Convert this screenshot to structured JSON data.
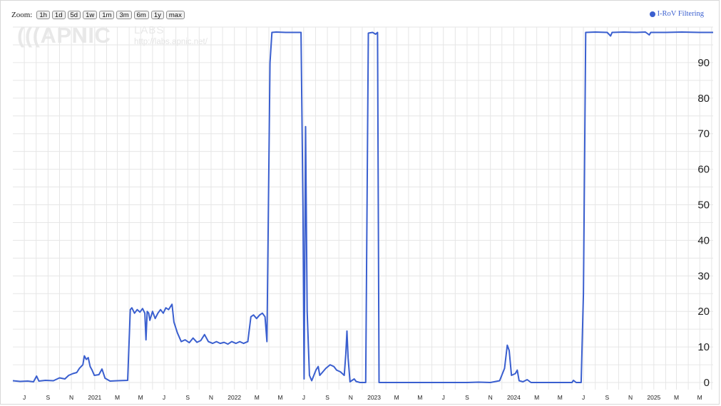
{
  "zoom": {
    "label": "Zoom:",
    "buttons": [
      "1h",
      "1d",
      "5d",
      "1w",
      "1m",
      "3m",
      "6m",
      "1y",
      "max"
    ]
  },
  "legend": {
    "label": "I-RoV Filtering",
    "color": "#3a5fcf"
  },
  "watermark": {
    "logo": "(((APNIC",
    "labs": "LABS",
    "url": "http://labs.apnic.net/"
  },
  "chart_data": {
    "type": "line",
    "title": "",
    "xlabel": "",
    "ylabel": "",
    "grid": true,
    "legend_position": "top-right",
    "y_axis_side": "right",
    "x_range": [
      "2020-06-01",
      "2025-06-05"
    ],
    "y_range": [
      -2,
      100
    ],
    "x_ticks": [
      {
        "label": "J",
        "date": "2020-07-01"
      },
      {
        "label": "S",
        "date": "2020-09-01"
      },
      {
        "label": "N",
        "date": "2020-11-01"
      },
      {
        "label": "2021",
        "date": "2021-01-01"
      },
      {
        "label": "M",
        "date": "2021-03-01"
      },
      {
        "label": "M",
        "date": "2021-05-01"
      },
      {
        "label": "J",
        "date": "2021-07-01"
      },
      {
        "label": "S",
        "date": "2021-09-01"
      },
      {
        "label": "N",
        "date": "2021-11-01"
      },
      {
        "label": "2022",
        "date": "2022-01-01"
      },
      {
        "label": "M",
        "date": "2022-03-01"
      },
      {
        "label": "M",
        "date": "2022-05-01"
      },
      {
        "label": "J",
        "date": "2022-07-01"
      },
      {
        "label": "S",
        "date": "2022-09-01"
      },
      {
        "label": "N",
        "date": "2022-11-01"
      },
      {
        "label": "2023",
        "date": "2023-01-01"
      },
      {
        "label": "M",
        "date": "2023-03-01"
      },
      {
        "label": "M",
        "date": "2023-05-01"
      },
      {
        "label": "J",
        "date": "2023-07-01"
      },
      {
        "label": "S",
        "date": "2023-09-01"
      },
      {
        "label": "N",
        "date": "2023-11-01"
      },
      {
        "label": "2024",
        "date": "2024-01-01"
      },
      {
        "label": "M",
        "date": "2024-03-01"
      },
      {
        "label": "M",
        "date": "2024-05-01"
      },
      {
        "label": "J",
        "date": "2024-07-01"
      },
      {
        "label": "S",
        "date": "2024-09-01"
      },
      {
        "label": "N",
        "date": "2024-11-01"
      },
      {
        "label": "2025",
        "date": "2025-01-01"
      },
      {
        "label": "M",
        "date": "2025-03-01"
      },
      {
        "label": "M",
        "date": "2025-05-01"
      }
    ],
    "y_ticks": [
      {
        "label": "0",
        "value": 0
      },
      {
        "label": "10",
        "value": 10
      },
      {
        "label": "20",
        "value": 20
      },
      {
        "label": "30",
        "value": 30
      },
      {
        "label": "40",
        "value": 40
      },
      {
        "label": "50",
        "value": 50
      },
      {
        "label": "60",
        "value": 60
      },
      {
        "label": "70",
        "value": 70
      },
      {
        "label": "80",
        "value": 80
      },
      {
        "label": "90",
        "value": 90
      }
    ],
    "series": [
      {
        "name": "I-RoV Filtering",
        "color": "#3a5fcf",
        "points": [
          [
            "2020-06-01",
            0.5
          ],
          [
            "2020-06-20",
            0.3
          ],
          [
            "2020-07-10",
            0.4
          ],
          [
            "2020-07-25",
            0.2
          ],
          [
            "2020-08-02",
            1.8
          ],
          [
            "2020-08-08",
            0.4
          ],
          [
            "2020-08-25",
            0.6
          ],
          [
            "2020-09-15",
            0.5
          ],
          [
            "2020-10-01",
            1.3
          ],
          [
            "2020-10-15",
            1.0
          ],
          [
            "2020-10-25",
            2.0
          ],
          [
            "2020-11-05",
            2.5
          ],
          [
            "2020-11-15",
            2.8
          ],
          [
            "2020-11-22",
            4.0
          ],
          [
            "2020-12-01",
            5.0
          ],
          [
            "2020-12-05",
            7.5
          ],
          [
            "2020-12-10",
            6.5
          ],
          [
            "2020-12-15",
            7.0
          ],
          [
            "2020-12-20",
            4.5
          ],
          [
            "2020-12-25",
            3.5
          ],
          [
            "2020-12-31",
            2.0
          ],
          [
            "2021-01-12",
            2.2
          ],
          [
            "2021-01-20",
            3.8
          ],
          [
            "2021-01-28",
            1.2
          ],
          [
            "2021-02-10",
            0.4
          ],
          [
            "2021-03-01",
            0.5
          ],
          [
            "2021-03-28",
            0.6
          ],
          [
            "2021-04-04",
            20.5
          ],
          [
            "2021-04-08",
            21.0
          ],
          [
            "2021-04-15",
            19.5
          ],
          [
            "2021-04-22",
            20.5
          ],
          [
            "2021-04-29",
            19.8
          ],
          [
            "2021-05-06",
            20.8
          ],
          [
            "2021-05-12",
            19.5
          ],
          [
            "2021-05-15",
            12.0
          ],
          [
            "2021-05-18",
            20.0
          ],
          [
            "2021-05-22",
            19.5
          ],
          [
            "2021-05-25",
            17.5
          ],
          [
            "2021-06-01",
            20.0
          ],
          [
            "2021-06-08",
            18.0
          ],
          [
            "2021-06-15",
            19.5
          ],
          [
            "2021-06-22",
            20.5
          ],
          [
            "2021-06-29",
            19.5
          ],
          [
            "2021-07-06",
            21.0
          ],
          [
            "2021-07-13",
            20.5
          ],
          [
            "2021-07-22",
            22.0
          ],
          [
            "2021-07-27",
            17.0
          ],
          [
            "2021-08-05",
            14.0
          ],
          [
            "2021-08-15",
            11.5
          ],
          [
            "2021-08-25",
            12.0
          ],
          [
            "2021-09-05",
            11.2
          ],
          [
            "2021-09-15",
            12.5
          ],
          [
            "2021-09-25",
            11.3
          ],
          [
            "2021-10-05",
            11.8
          ],
          [
            "2021-10-15",
            13.5
          ],
          [
            "2021-10-25",
            11.5
          ],
          [
            "2021-11-05",
            11.0
          ],
          [
            "2021-11-15",
            11.5
          ],
          [
            "2021-11-25",
            11.0
          ],
          [
            "2021-12-05",
            11.3
          ],
          [
            "2021-12-15",
            10.8
          ],
          [
            "2021-12-25",
            11.5
          ],
          [
            "2022-01-05",
            11.0
          ],
          [
            "2022-01-15",
            11.5
          ],
          [
            "2022-01-25",
            11.0
          ],
          [
            "2022-02-05",
            11.5
          ],
          [
            "2022-02-13",
            18.5
          ],
          [
            "2022-02-20",
            19.0
          ],
          [
            "2022-02-28",
            18.0
          ],
          [
            "2022-03-08",
            19.0
          ],
          [
            "2022-03-15",
            19.5
          ],
          [
            "2022-03-22",
            18.5
          ],
          [
            "2022-03-27",
            11.5
          ],
          [
            "2022-04-04",
            90.0
          ],
          [
            "2022-04-09",
            98.5
          ],
          [
            "2022-04-20",
            98.6
          ],
          [
            "2022-05-15",
            98.5
          ],
          [
            "2022-06-10",
            98.5
          ],
          [
            "2022-06-24",
            98.5
          ],
          [
            "2022-06-29",
            50.0
          ],
          [
            "2022-07-02",
            1.0
          ],
          [
            "2022-07-06",
            72.0
          ],
          [
            "2022-07-10",
            20.0
          ],
          [
            "2022-07-16",
            2.0
          ],
          [
            "2022-07-22",
            0.5
          ],
          [
            "2022-08-02",
            3.5
          ],
          [
            "2022-08-08",
            4.5
          ],
          [
            "2022-08-12",
            2.0
          ],
          [
            "2022-08-20",
            3.0
          ],
          [
            "2022-08-28",
            4.0
          ],
          [
            "2022-09-08",
            5.0
          ],
          [
            "2022-09-18",
            4.5
          ],
          [
            "2022-09-25",
            3.5
          ],
          [
            "2022-10-05",
            3.0
          ],
          [
            "2022-10-15",
            2.0
          ],
          [
            "2022-10-19",
            8.0
          ],
          [
            "2022-10-22",
            14.5
          ],
          [
            "2022-10-25",
            7.0
          ],
          [
            "2022-10-30",
            0.2
          ],
          [
            "2022-11-10",
            1.0
          ],
          [
            "2022-11-15",
            0.3
          ],
          [
            "2022-11-25",
            0.0
          ],
          [
            "2022-12-10",
            0.0
          ],
          [
            "2022-12-17",
            98.3
          ],
          [
            "2022-12-28",
            98.5
          ],
          [
            "2023-01-05",
            98.0
          ],
          [
            "2023-01-10",
            98.5
          ],
          [
            "2023-01-14",
            0.0
          ],
          [
            "2023-03-01",
            0.0
          ],
          [
            "2023-05-01",
            0.0
          ],
          [
            "2023-07-01",
            0.0
          ],
          [
            "2023-09-01",
            0.0
          ],
          [
            "2023-10-01",
            0.1
          ],
          [
            "2023-11-01",
            0.0
          ],
          [
            "2023-11-25",
            0.5
          ],
          [
            "2023-12-08",
            4.0
          ],
          [
            "2023-12-15",
            10.5
          ],
          [
            "2023-12-20",
            9.0
          ],
          [
            "2023-12-26",
            2.0
          ],
          [
            "2024-01-05",
            2.5
          ],
          [
            "2024-01-10",
            3.5
          ],
          [
            "2024-01-15",
            0.5
          ],
          [
            "2024-01-25",
            0.2
          ],
          [
            "2024-02-05",
            0.8
          ],
          [
            "2024-02-15",
            0.0
          ],
          [
            "2024-03-15",
            0.0
          ],
          [
            "2024-05-01",
            0.0
          ],
          [
            "2024-06-01",
            0.0
          ],
          [
            "2024-06-05",
            0.6
          ],
          [
            "2024-06-12",
            0.0
          ],
          [
            "2024-06-25",
            0.0
          ],
          [
            "2024-07-01",
            25.0
          ],
          [
            "2024-07-07",
            98.5
          ],
          [
            "2024-08-01",
            98.6
          ],
          [
            "2024-09-01",
            98.5
          ],
          [
            "2024-09-10",
            97.5
          ],
          [
            "2024-09-14",
            98.5
          ],
          [
            "2024-10-15",
            98.6
          ],
          [
            "2024-11-15",
            98.5
          ],
          [
            "2024-12-10",
            98.6
          ],
          [
            "2024-12-20",
            97.8
          ],
          [
            "2024-12-24",
            98.5
          ],
          [
            "2025-02-01",
            98.5
          ],
          [
            "2025-03-15",
            98.6
          ],
          [
            "2025-04-30",
            98.5
          ],
          [
            "2025-06-05",
            98.5
          ]
        ]
      }
    ]
  }
}
